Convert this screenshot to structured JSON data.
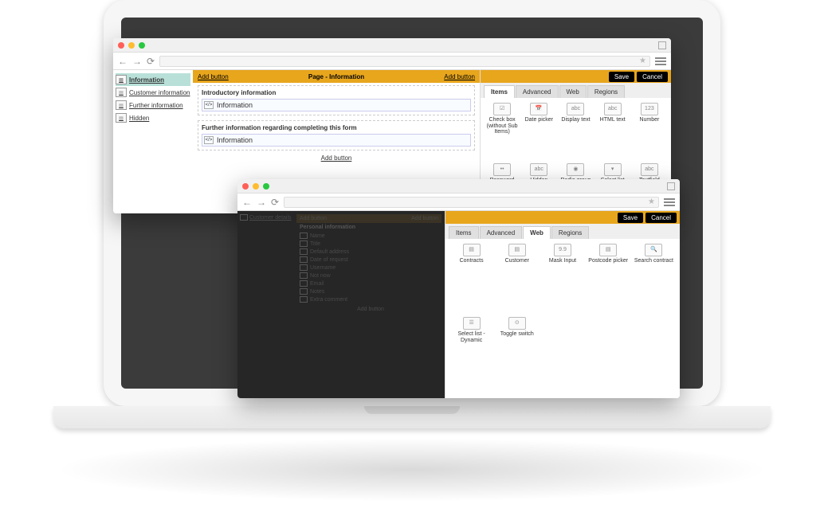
{
  "window1": {
    "sidebar": {
      "items": [
        {
          "label": "Information",
          "active": true
        },
        {
          "label": "Customer information",
          "active": false
        },
        {
          "label": "Further information",
          "active": false
        },
        {
          "label": "Hidden",
          "active": false
        }
      ]
    },
    "page": {
      "add_left": "Add button",
      "title": "Page - Information",
      "add_right": "Add button",
      "add_bottom": "Add button"
    },
    "sections": [
      {
        "title": "Introductory information",
        "field": "Information"
      },
      {
        "title": "Further information regarding completing this form",
        "field": "Information"
      }
    ],
    "panel": {
      "save": "Save",
      "cancel": "Cancel",
      "tabs": [
        "Items",
        "Advanced",
        "Web",
        "Regions"
      ],
      "active_tab": 0,
      "items": [
        {
          "label": "Check box (without Sub Items)",
          "ic": "☑"
        },
        {
          "label": "Date picker",
          "ic": "📅"
        },
        {
          "label": "Display text",
          "ic": "abc"
        },
        {
          "label": "HTML text",
          "ic": "abc"
        },
        {
          "label": "Number",
          "ic": "123"
        },
        {
          "label": "Password",
          "ic": "••"
        },
        {
          "label": "Hidden",
          "ic": "abc"
        },
        {
          "label": "Radio group",
          "ic": "◉"
        },
        {
          "label": "Select list",
          "ic": "▾"
        },
        {
          "label": "Textfield",
          "ic": "abc"
        }
      ]
    }
  },
  "window2": {
    "dark": {
      "side_item": "Customer details",
      "header_left": "Add button",
      "header_title": "",
      "header_right": "Add button",
      "section_title": "Personal information",
      "rows": [
        "Name",
        "Title",
        "Default address",
        "Date of request",
        "Username",
        "Not now",
        "Email",
        "Notes",
        "Extra comment"
      ],
      "add": "Add button"
    },
    "panel": {
      "save": "Save",
      "cancel": "Cancel",
      "tabs": [
        "Items",
        "Advanced",
        "Web",
        "Regions"
      ],
      "active_tab": 2,
      "items": [
        {
          "label": "Contracts",
          "ic": "▤"
        },
        {
          "label": "Customer",
          "ic": "▤"
        },
        {
          "label": "Mask Input",
          "ic": "9.9"
        },
        {
          "label": "Postcode picker",
          "ic": "▤"
        },
        {
          "label": "Search contract",
          "ic": "🔍"
        },
        {
          "label": "Select list - Dynamic",
          "ic": "☰"
        },
        {
          "label": "Toggle switch",
          "ic": "⊙"
        }
      ]
    }
  }
}
